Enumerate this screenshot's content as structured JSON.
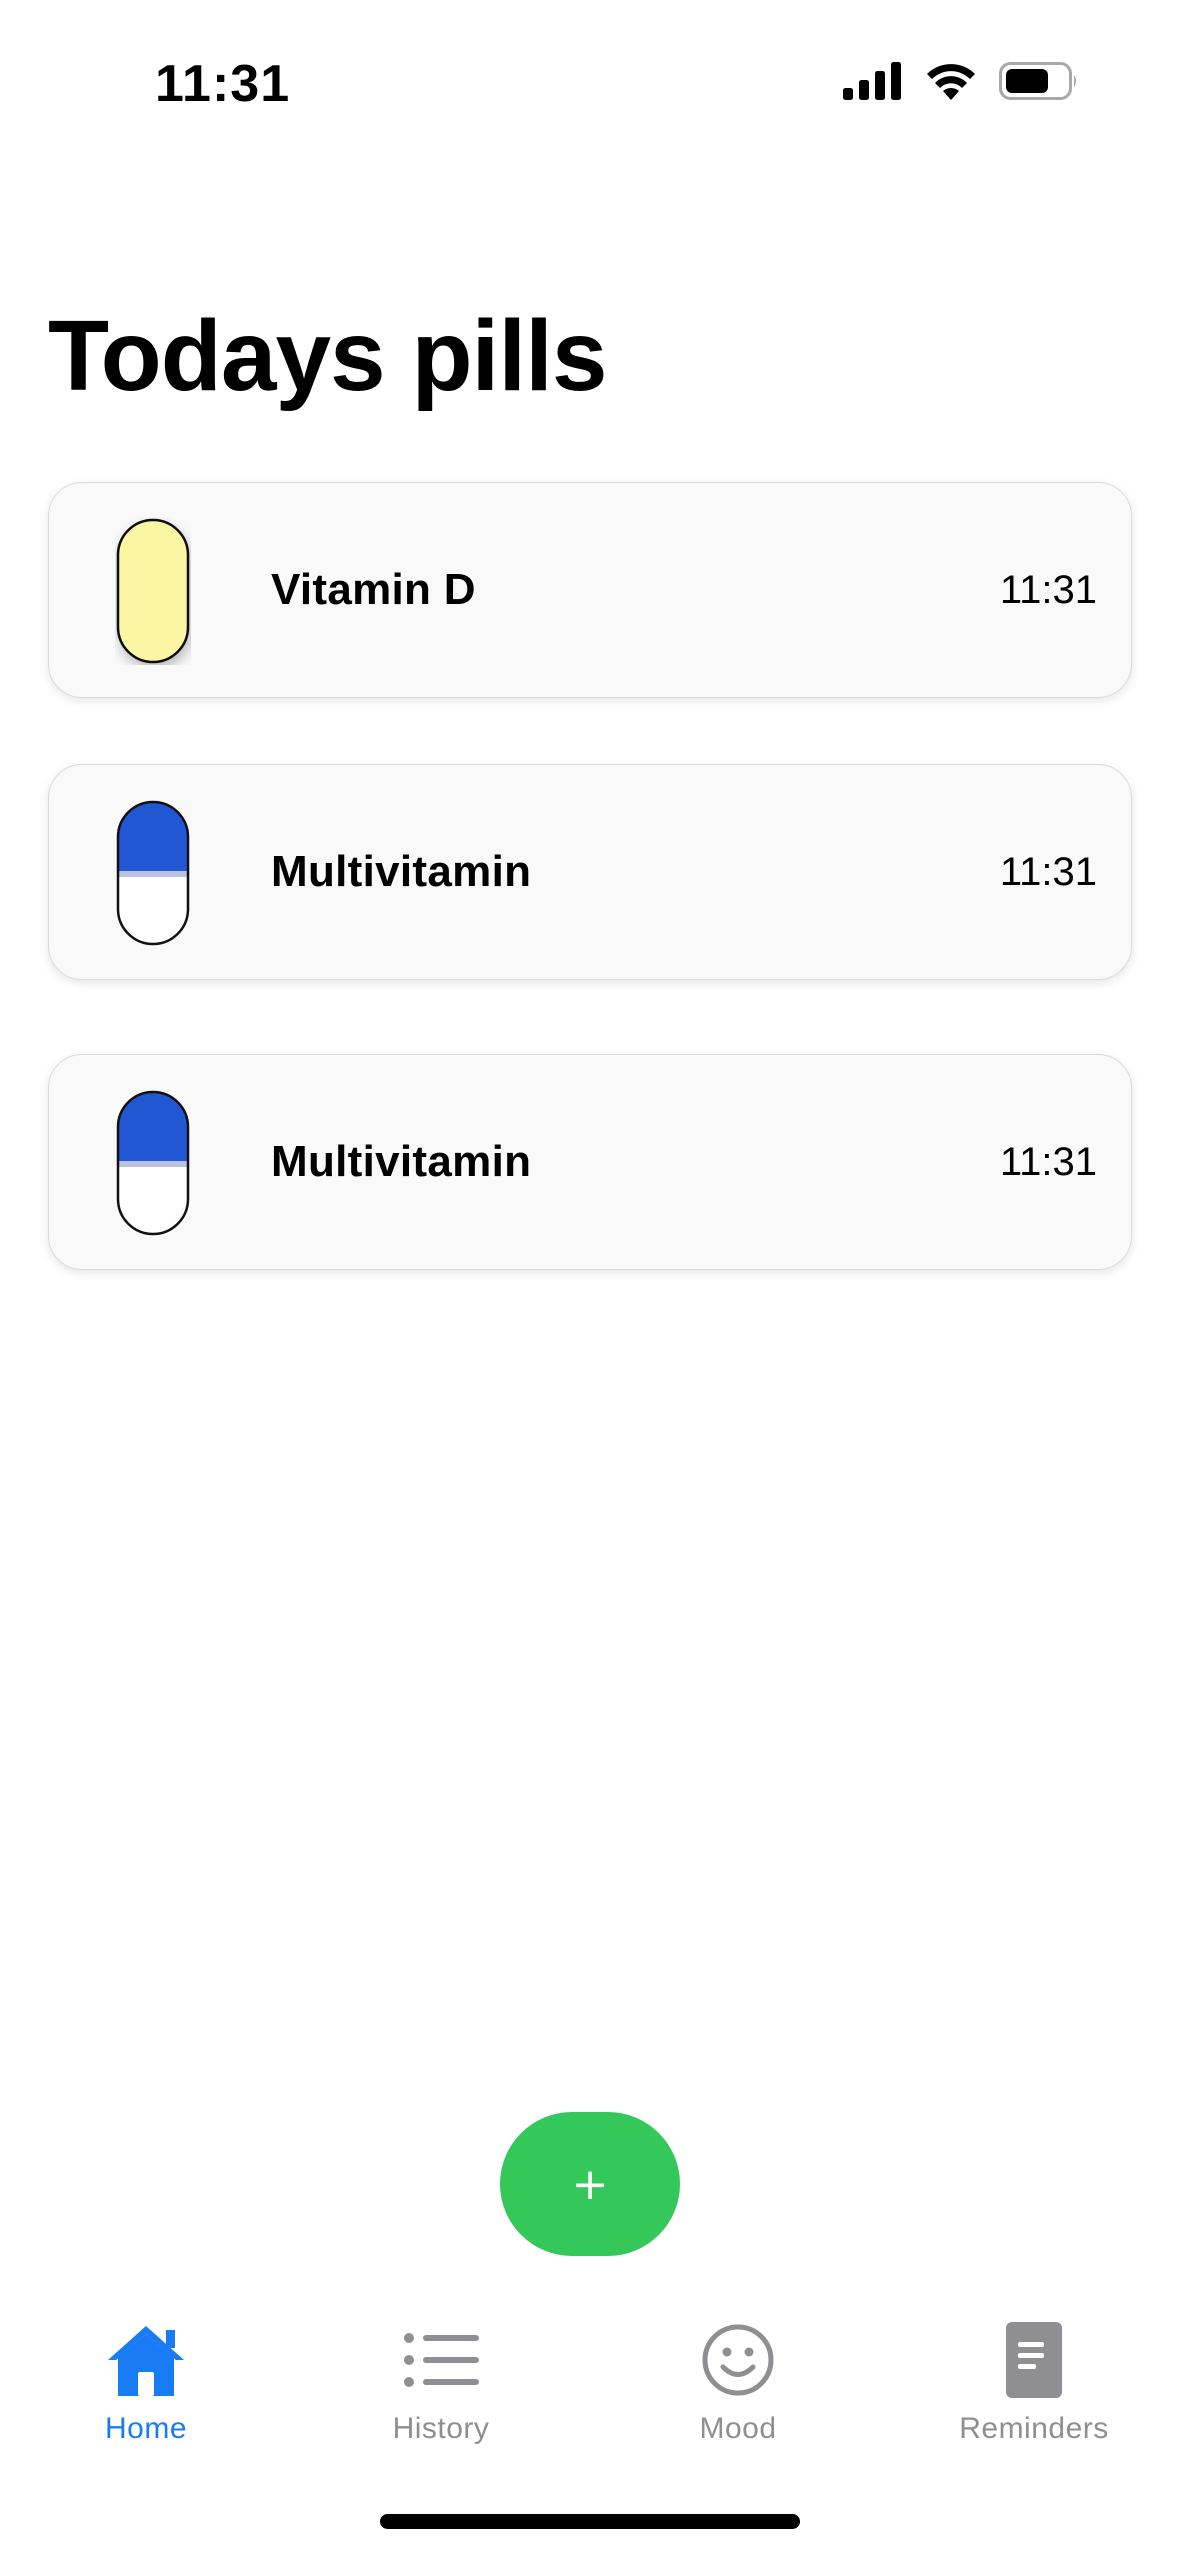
{
  "status_bar": {
    "time": "11:31",
    "icons": [
      "cellular-signal-icon",
      "wifi-icon",
      "battery-icon"
    ]
  },
  "page": {
    "title": "Todays pills"
  },
  "pills": [
    {
      "name": "Vitamin D",
      "time": "11:31",
      "icon": "softgel-pill-icon",
      "color": "#fbf6a4"
    },
    {
      "name": "Multivitamin",
      "time": "11:31",
      "icon": "capsule-pill-icon",
      "color": "#2257d4"
    },
    {
      "name": "Multivitamin",
      "time": "11:31",
      "icon": "capsule-pill-icon",
      "color": "#2257d4"
    }
  ],
  "add_button": {
    "label": "+",
    "color": "#34c759"
  },
  "tab_bar": {
    "active_color": "#1a7cf5",
    "inactive_color": "#8e8e93",
    "tabs": [
      {
        "label": "Home",
        "icon": "house-icon",
        "active": true
      },
      {
        "label": "History",
        "icon": "list-icon",
        "active": false
      },
      {
        "label": "Mood",
        "icon": "smiley-face-icon",
        "active": false
      },
      {
        "label": "Reminders",
        "icon": "document-icon",
        "active": false
      }
    ]
  }
}
